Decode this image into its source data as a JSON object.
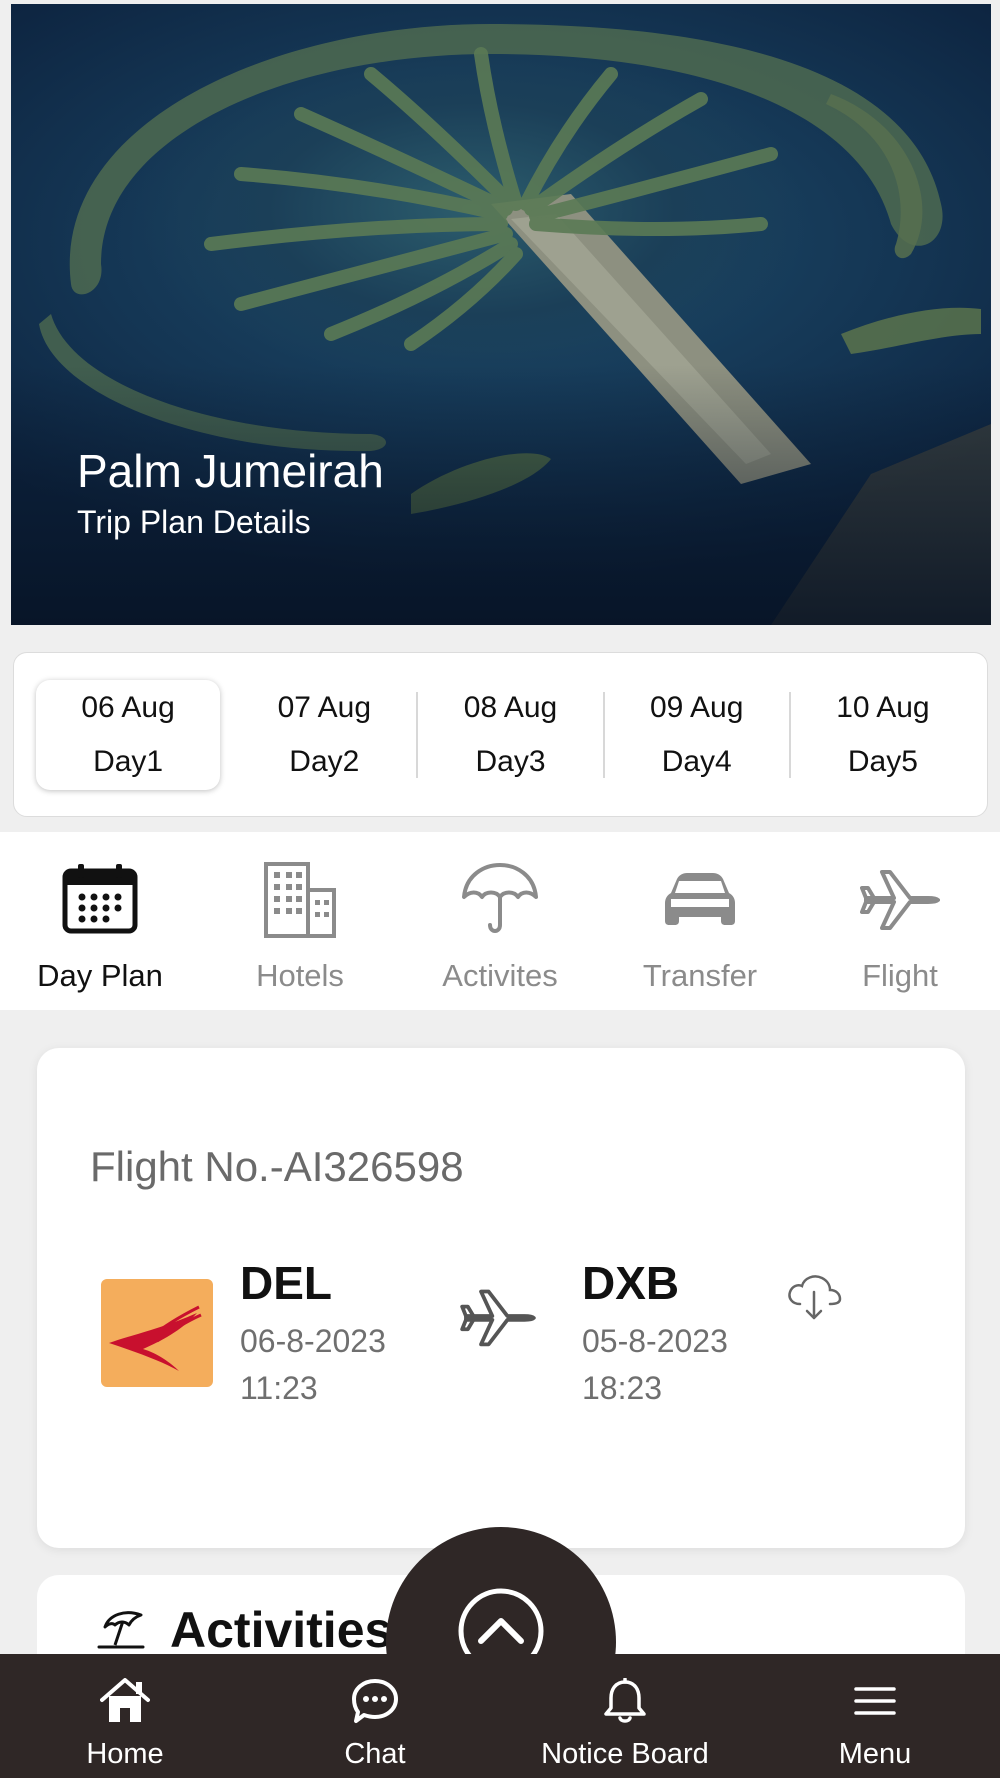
{
  "hero": {
    "title": "Palm Jumeirah",
    "subtitle": "Trip Plan Details"
  },
  "days": [
    {
      "date": "06 Aug",
      "label": "Day1",
      "active": true
    },
    {
      "date": "07 Aug",
      "label": "Day2",
      "active": false
    },
    {
      "date": "08 Aug",
      "label": "Day3",
      "active": false
    },
    {
      "date": "09 Aug",
      "label": "Day4",
      "active": false
    },
    {
      "date": "10 Aug",
      "label": "Day5",
      "active": false
    }
  ],
  "tabs": [
    {
      "label": "Day Plan",
      "icon": "calendar-icon",
      "active": true
    },
    {
      "label": "Hotels",
      "icon": "building-icon",
      "active": false
    },
    {
      "label": "Activites",
      "icon": "umbrella-icon",
      "active": false
    },
    {
      "label": "Transfer",
      "icon": "car-icon",
      "active": false
    },
    {
      "label": "Flight",
      "icon": "airplane-icon",
      "active": false
    }
  ],
  "flight": {
    "number": "Flight No.-AI326598",
    "airline_logo_color": "#f4ad5c",
    "from": {
      "code": "DEL",
      "datetime": "06-8-2023 11:23"
    },
    "to": {
      "code": "DXB",
      "datetime": "05-8-2023 18:23"
    }
  },
  "activities": {
    "title": "Activities"
  },
  "bottom_nav": [
    {
      "label": "Home",
      "icon": "home-icon"
    },
    {
      "label": "Chat",
      "icon": "chat-icon"
    },
    {
      "label": "Notice Board",
      "icon": "bell-icon"
    },
    {
      "label": "Menu",
      "icon": "menu-icon"
    }
  ],
  "colors": {
    "nav_bg": "#2f2726",
    "active_text": "#111111",
    "inactive_text": "#8b8b8b"
  }
}
